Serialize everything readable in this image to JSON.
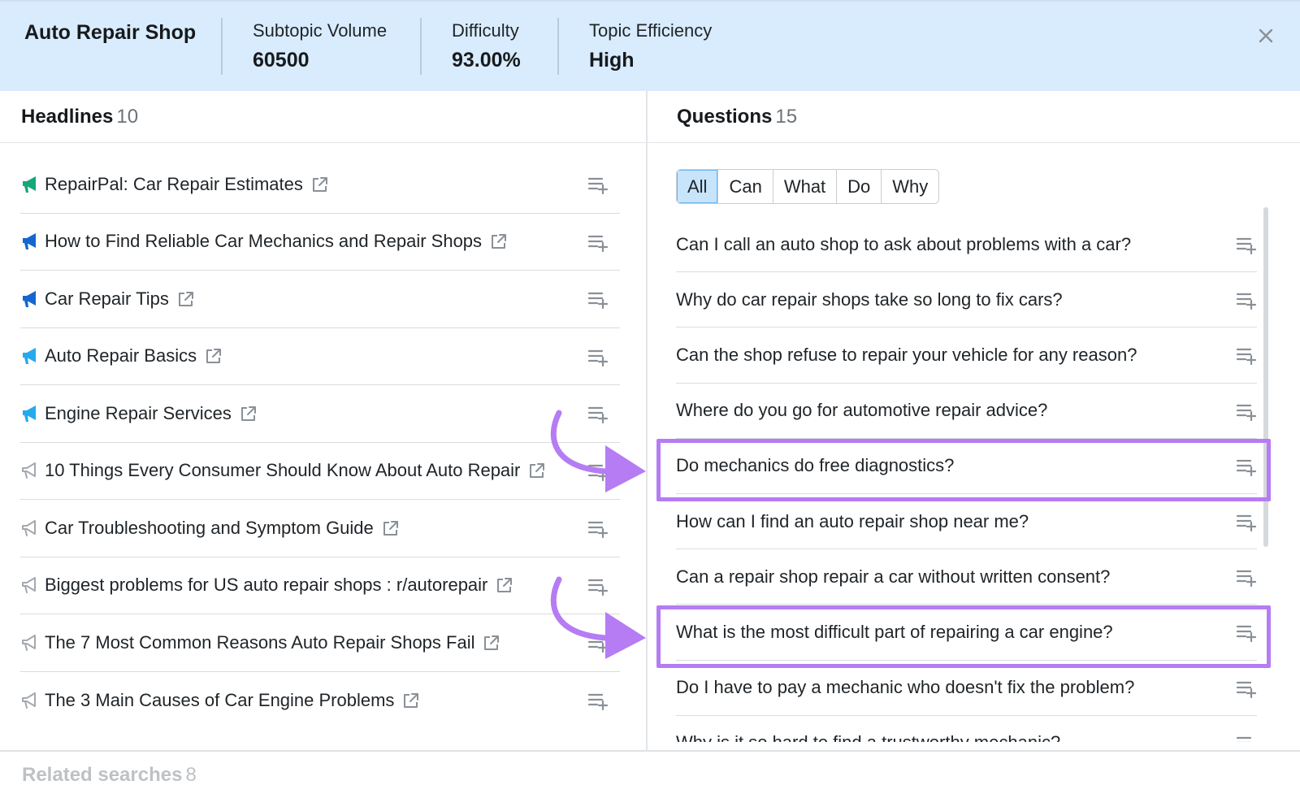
{
  "header": {
    "title": "Auto Repair Shop",
    "metrics": [
      {
        "label": "Subtopic Volume",
        "value": "60500"
      },
      {
        "label": "Difficulty",
        "value": "93.00%"
      },
      {
        "label": "Topic Efficiency",
        "value": "High"
      }
    ]
  },
  "headlines": {
    "title": "Headlines",
    "count": "10",
    "items": [
      {
        "text": "RepairPal: Car Repair Estimates",
        "icon_color": "#16a77a"
      },
      {
        "text": "How to Find Reliable Car Mechanics and Repair Shops",
        "icon_color": "#1466d0"
      },
      {
        "text": "Car Repair Tips",
        "icon_color": "#1466d0"
      },
      {
        "text": "Auto Repair Basics",
        "icon_color": "#25a9ef"
      },
      {
        "text": "Engine Repair Services",
        "icon_color": "#25a9ef"
      },
      {
        "text": "10 Things Every Consumer Should Know About Auto Repair",
        "icon_color": "#a3a9af"
      },
      {
        "text": "Car Troubleshooting and Symptom Guide",
        "icon_color": "#a3a9af"
      },
      {
        "text": "Biggest problems for US auto repair shops : r/autorepair",
        "icon_color": "#a3a9af"
      },
      {
        "text": "The 7 Most Common Reasons Auto Repair Shops Fail",
        "icon_color": "#a3a9af"
      },
      {
        "text": "The 3 Main Causes of Car Engine Problems",
        "icon_color": "#a3a9af"
      }
    ]
  },
  "questions": {
    "title": "Questions",
    "count": "15",
    "filters": [
      "All",
      "Can",
      "What",
      "Do",
      "Why"
    ],
    "active_filter": "All",
    "items": [
      "Can I call an auto shop to ask about problems with a car?",
      "Why do car repair shops take so long to fix cars?",
      "Can the shop refuse to repair your vehicle for any reason?",
      "Where do you go for automotive repair advice?",
      "Do mechanics do free diagnostics?",
      "How can I find an auto repair shop near me?",
      "Can a repair shop repair a car without written consent?",
      "What is the most difficult part of repairing a car engine?",
      "Do I have to pay a mechanic who doesn't fix the problem?",
      "Why is it so hard to find a trustworthy mechanic?"
    ],
    "highlighted": [
      "Do mechanics do free diagnostics?",
      "What is the most difficult part of repairing a car engine?"
    ]
  },
  "related": {
    "title": "Related searches",
    "count": "8"
  },
  "colors": {
    "header_bg": "#d9ecfd",
    "highlight": "#b57cf4",
    "active_filter_bg": "#c7e4fb"
  }
}
